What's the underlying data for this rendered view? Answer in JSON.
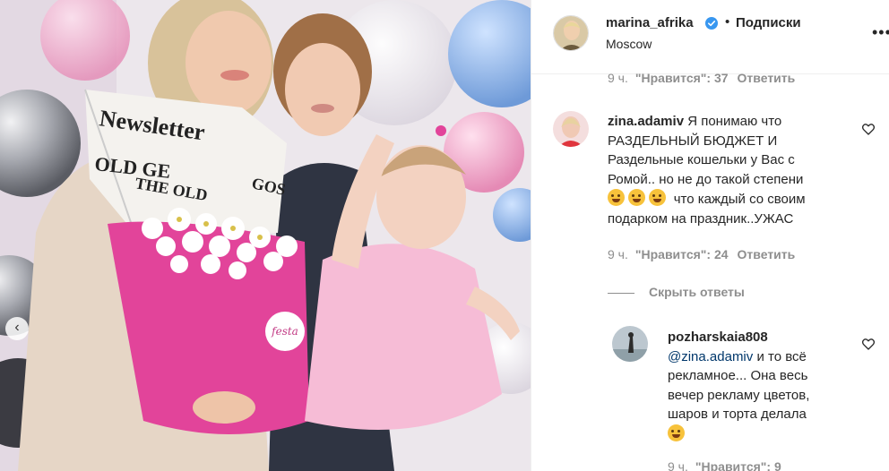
{
  "post": {
    "username": "marina_afrika",
    "separator": "•",
    "follow_label": "Подписки",
    "location": "Moscow",
    "more_label": "•••"
  },
  "photo": {
    "logo_text": "festa",
    "newspaper_texts": [
      "Newsletter",
      "OLD GE",
      "THE OLD",
      "GOS"
    ]
  },
  "comments": [
    {
      "meta": {
        "time": "9 ч.",
        "likes": "\"Нравится\": 37",
        "reply": "Ответить"
      }
    },
    {
      "username": "zina.adamiv",
      "text_1": "Я понимаю что",
      "text_2": "РАЗДЕЛЬНЫЙ БЮДЖЕТ И",
      "text_3": "Раздельные кошельки у Вас с",
      "text_4": "Ромой.. но не до такой степени",
      "text_5": "что каждый со своим",
      "text_6": "подарком на праздник..УЖАС",
      "meta": {
        "time": "9 ч.",
        "likes": "\"Нравится\": 24",
        "reply": "Ответить"
      }
    }
  ],
  "hide_replies_label": "Скрыть ответы",
  "reply": {
    "username": "pozharskaia808",
    "mention": "@zina.adamiv",
    "text_1": "и то всё",
    "text_2": "рекламное... Она весь",
    "text_3": "вечер рекламу цветов,",
    "text_4": "шаров и торта делала",
    "meta": {
      "time": "9 ч.",
      "likes": "\"Нравится\": 9"
    }
  },
  "colors": {
    "verified": "#3897f0",
    "bouquet": "#e2449a",
    "dress": "#f6bcd6"
  }
}
